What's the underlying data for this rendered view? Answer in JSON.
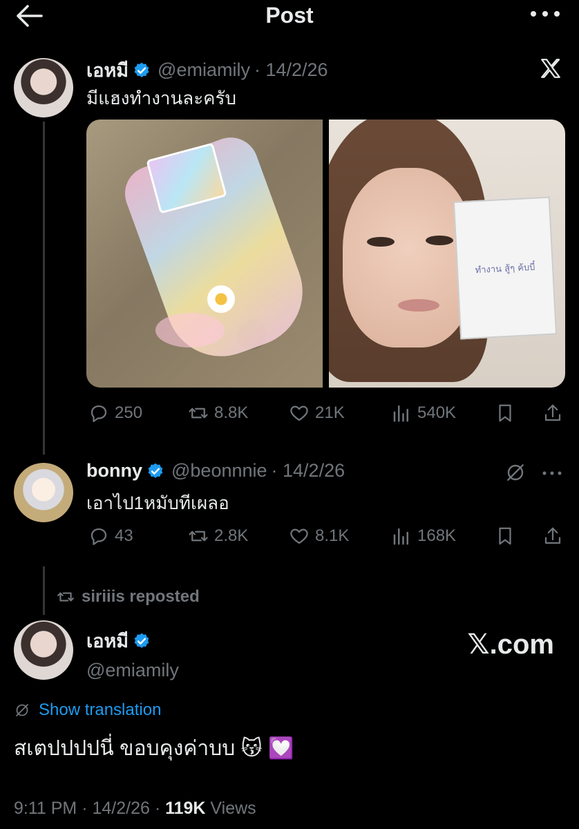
{
  "header": {
    "title": "Post"
  },
  "post": {
    "author_name": "เอหมี",
    "author_handle": "@emiamily",
    "date": "· 14/2/26",
    "text": "มีแฮงทำงานละครับ",
    "stats": {
      "replies": "250",
      "reposts": "8.8K",
      "likes": "21K",
      "views": "540K"
    },
    "card_text": "ทำงาน สู้ๆ ค้บบี๋"
  },
  "reply": {
    "author_name": "bonny",
    "author_handle": "@beonnnie",
    "date": "· 14/2/26",
    "text": "เอาไป1หมับทีเผลอ",
    "stats": {
      "replies": "43",
      "reposts": "2.8K",
      "likes": "8.1K",
      "views": "168K"
    }
  },
  "repost_label": "siriiis reposted",
  "main_post": {
    "author_name": "เอหมี",
    "author_handle": "@emiamily",
    "brand": "𝕏.com",
    "show_translation": "Show translation",
    "text": "สเตปปปปนี่ ขอบคุงค่าบบ",
    "emoji": "😽 💟",
    "time": "9:11 PM · 14/2/26 · ",
    "views_count": "119K",
    "views_label": " Views"
  },
  "colors": {
    "background": "#000000",
    "text": "#e7e9ea",
    "muted": "#71767b",
    "accent": "#1d9bf0"
  }
}
